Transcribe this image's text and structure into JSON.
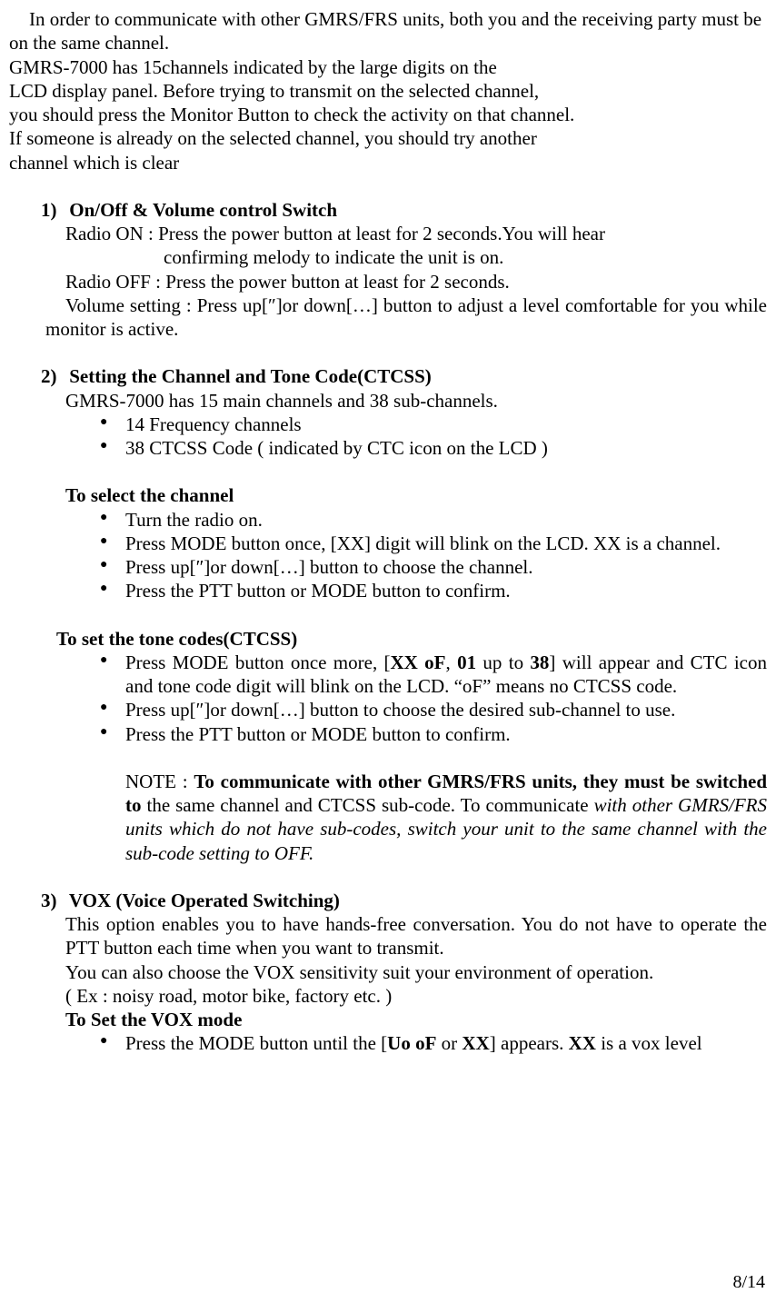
{
  "intro": {
    "p1": "In order to communicate with other GMRS/FRS units, both you and the receiving party must be on the same channel.",
    "p2": "GMRS-7000 has 15channels indicated by the large digits on the",
    "p3": "LCD display panel. Before trying to transmit on the selected channel,",
    "p4": "you should press the Monitor Button to check the activity on that channel.",
    "p5": "If someone is already on the selected channel, you should try another",
    "p6": "channel which is clear"
  },
  "s1": {
    "num": "1)",
    "title": "On/Off & Volume control Switch",
    "radio_on": "Radio ON : Press the power button at least for 2 seconds.You will hear",
    "confirming": "confirming melody to indicate the unit is on.",
    "radio_off": "Radio OFF : Press the power button at least for 2 seconds.",
    "volume": "Volume setting : Press up[″]or down[…] button to adjust a level  comfortable for you while monitor is active."
  },
  "s2": {
    "num": "2)",
    "title": "Setting the Channel and Tone Code(CTCSS)",
    "intro": "GMRS-7000 has 15 main channels and 38 sub-channels.",
    "b1": "14 Frequency channels",
    "b2": "38 CTCSS Code ( indicated by CTC icon on the LCD )",
    "select_ch_title": "To select the channel",
    "sc1": "Turn the radio on.",
    "sc2": "Press MODE button once, [XX] digit will blink on the LCD. XX is a channel.",
    "sc3": "Press up[″]or down[…] button to choose the channel.",
    "sc4": "Press the PTT button or MODE button to confirm.",
    "tone_title": "To set the tone codes(CTCSS)",
    "tc1a": "Press MODE button once more, [",
    "tc1b": "XX oF",
    "tc1c": ", ",
    "tc1d": "01",
    "tc1e": " up to ",
    "tc1f": "38",
    "tc1g": "] will appear and CTC icon and tone code digit will blink on the LCD. “oF” means no CTCSS code.",
    "tc2": "Press up[″]or down[…] button to choose the desired sub-channel to use.",
    "tc3": "Press the PTT button or MODE button to confirm.",
    "note_label": "NOTE : ",
    "note_bold": "To communicate with other GMRS/FRS units, they must be switched to ",
    "note_plain": "the same channel and CTCSS sub-code. To communicate ",
    "note_italic": "with other GMRS/FRS units which do not have sub-codes, switch your unit to the same channel with the sub-code setting to OFF."
  },
  "s3": {
    "num": "3)",
    "title": "VOX (Voice Operated Switching)",
    "p1": "This option enables you to have hands-free conversation. You do not have to operate the PTT button each time when you want to transmit.",
    "p2": "You can also choose the VOX sensitivity suit your environment of operation.",
    "p3": "( Ex : noisy road, motor bike, factory etc. )",
    "set_title": "To Set the VOX mode",
    "b1a": "Press the MODE button until the [",
    "b1b": "Uo oF",
    "b1c": " or ",
    "b1d": "XX",
    "b1e": "] appears. ",
    "b1f": "XX",
    "b1g": " is a vox level"
  },
  "page": "8/14"
}
